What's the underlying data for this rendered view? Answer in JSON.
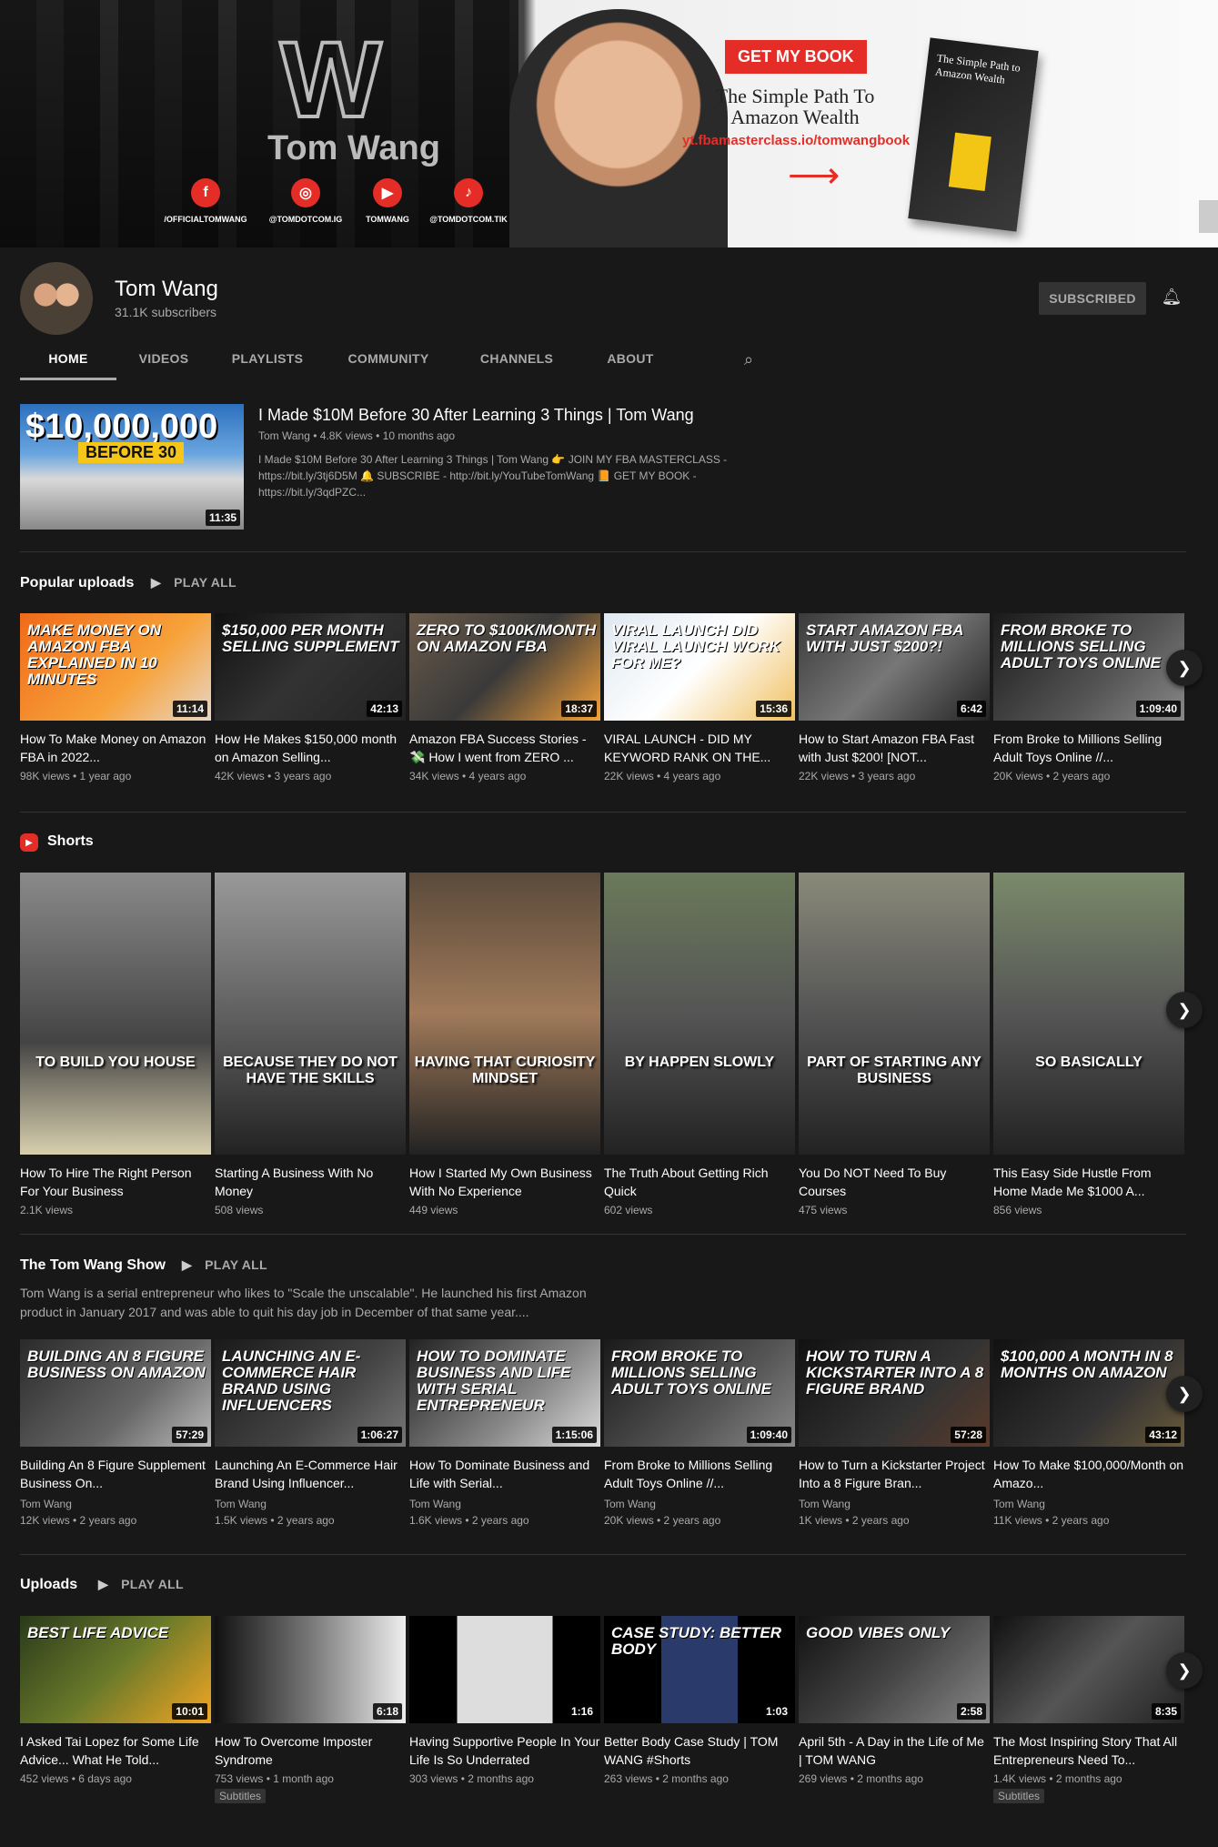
{
  "banner": {
    "logo_letter": "W",
    "logo_name": "Tom Wang",
    "socials": [
      {
        "icon": "facebook-icon",
        "glyph": "f",
        "label": "/OFFICIALTOMWANG"
      },
      {
        "icon": "instagram-icon",
        "glyph": "◎",
        "label": "@TOMDOTCOM.IG"
      },
      {
        "icon": "youtube-icon",
        "glyph": "▶",
        "label": "TOMWANG"
      },
      {
        "icon": "tiktok-icon",
        "glyph": "♪",
        "label": "@TOMDOTCOM.TIK"
      }
    ],
    "cta": "GET MY BOOK",
    "book_title": "The Simple Path To Amazon Wealth",
    "book_url": "yt.fbamasterclass.io/tomwangbook",
    "book_cover": "The Simple Path to Amazon Wealth"
  },
  "channel": {
    "name": "Tom Wang",
    "subscribers": "31.1K subscribers",
    "subscribe_label": "SUBSCRIBED"
  },
  "tabs": [
    "HOME",
    "VIDEOS",
    "PLAYLISTS",
    "COMMUNITY",
    "CHANNELS",
    "ABOUT"
  ],
  "featured": {
    "thumb_line1": "$10,000,000",
    "thumb_line2": "BEFORE 30",
    "duration": "11:35",
    "title": "I Made $10M Before 30 After Learning 3 Things | Tom Wang",
    "meta": "Tom Wang • 4.8K views • 10 months ago",
    "description": "I Made $10M Before 30 After Learning 3 Things | Tom Wang 👉 JOIN MY FBA MASTERCLASS - https://bit.ly/3tj6D5M 🔔 SUBSCRIBE - http://bit.ly/YouTubeTomWang 📙 GET MY BOOK - https://bit.ly/3qdPZC..."
  },
  "popular": {
    "title": "Popular uploads",
    "play_all": "PLAY ALL",
    "items": [
      {
        "cap": "MAKE MONEY ON AMAZON FBA explained in 10 minutes",
        "dur": "11:14",
        "title": "How To Make Money on Amazon FBA in 2022...",
        "meta": "98K views • 1 year ago",
        "bg": "linear-gradient(135deg,#f06a1a,#f7a23a 60%,#e7d6c5)"
      },
      {
        "cap": "$150,000 PER MONTH SELLING SUPPLEMENT",
        "dur": "42:13",
        "title": "How He Makes $150,000 month on Amazon Selling...",
        "meta": "42K views • 3 years ago",
        "bg": "linear-gradient(135deg,#111,#333 50%,#222)"
      },
      {
        "cap": "ZERO TO $100K/MONTH ON AMAZON FBA",
        "dur": "18:37",
        "title": "Amazon FBA Success Stories - 💸 How I went from ZERO ...",
        "meta": "34K views • 4 years ago",
        "bg": "linear-gradient(135deg,#6a5a4a,#3a3a3a 50%,#f7a23a)"
      },
      {
        "cap": "VIRAL LAUNCH DID VIRAL LAUNCH WORK FOR ME?",
        "dur": "15:36",
        "title": "VIRAL LAUNCH - DID MY KEYWORD RANK ON THE...",
        "meta": "22K views • 4 years ago",
        "bg": "linear-gradient(135deg,#dfe8f0,#ffffff 50%,#f0c060)"
      },
      {
        "cap": "START AMAZON FBA WITH JUST $200?!",
        "dur": "6:42",
        "title": "How to Start Amazon FBA Fast with Just $200! [NOT...",
        "meta": "22K views • 3 years ago",
        "bg": "linear-gradient(135deg,#3a3a3a,#777 50%,#222)"
      },
      {
        "cap": "FROM BROKE TO MILLIONS SELLING ADULT TOYS ONLINE",
        "dur": "1:09:40",
        "title": "From Broke to Millions Selling Adult Toys Online //...",
        "meta": "20K views • 2 years ago",
        "bg": "linear-gradient(135deg,#1a1a1a,#555 60%,#888)"
      }
    ]
  },
  "shorts": {
    "title": "Shorts",
    "items": [
      {
        "cap": "TO BUILD YOU HOUSE",
        "title": "How To Hire The Right Person For Your Business",
        "meta": "2.1K views",
        "bg": "linear-gradient(180deg,#8a8a8a,#444 60%,#d8cfae)"
      },
      {
        "cap": "BECAUSE THEY DO NOT HAVE THE SKILLS",
        "title": "Starting A Business With No Money",
        "meta": "508 views",
        "bg": "linear-gradient(180deg,#999,#555 60%,#222)"
      },
      {
        "cap": "HAVING THAT CURIOSITY MINDSET",
        "title": "How I Started My Own Business With No Experience",
        "meta": "449 views",
        "bg": "linear-gradient(180deg,#5a4a3a,#a07a5a 50%,#222)"
      },
      {
        "cap": "BY HAPPEN SLOWLY",
        "title": "The Truth About Getting Rich Quick",
        "meta": "602 views",
        "bg": "linear-gradient(180deg,#6a7a5a,#555 50%,#222)"
      },
      {
        "cap": "PART OF STARTING ANY BUSINESS",
        "title": "You Do NOT Need To Buy Courses",
        "meta": "475 views",
        "bg": "linear-gradient(180deg,#8a8a7a,#555 50%,#222)"
      },
      {
        "cap": "SO BASICALLY",
        "title": "This Easy Side Hustle From Home Made Me $1000 A...",
        "meta": "856 views",
        "bg": "linear-gradient(180deg,#7a8a6a,#555 50%,#222)"
      }
    ]
  },
  "show": {
    "title": "The Tom Wang Show",
    "play_all": "PLAY ALL",
    "description": "Tom Wang is a serial entrepreneur who likes to \"Scale the unscalable\". He launched his first Amazon product in January 2017 and was able to quit his day job in December of that same year....",
    "items": [
      {
        "cap": "BUILDING AN 8 FIGURE BUSINESS ON AMAZON",
        "dur": "57:29",
        "title": "Building An 8 Figure Supplement Business On...",
        "channel": "Tom Wang",
        "meta": "12K views • 2 years ago",
        "bg": "linear-gradient(135deg,#2a2a2a,#666 60%,#bbb)"
      },
      {
        "cap": "LAUNCHING AN E-COMMERCE HAIR BRAND USING INFLUENCERS",
        "dur": "1:06:27",
        "title": "Launching An E-Commerce Hair Brand Using Influencer...",
        "channel": "Tom Wang",
        "meta": "1.5K views • 2 years ago",
        "bg": "linear-gradient(135deg,#1a1a1a,#444 60%,#777)"
      },
      {
        "cap": "HOW TO DOMINATE BUSINESS AND LIFE WITH SERIAL ENTREPRENEUR",
        "dur": "1:15:06",
        "title": "How To Dominate Business and Life with Serial...",
        "channel": "Tom Wang",
        "meta": "1.6K views • 2 years ago",
        "bg": "linear-gradient(135deg,#222,#888 60%,#ddd)"
      },
      {
        "cap": "FROM BROKE TO MILLIONS SELLING ADULT TOYS ONLINE",
        "dur": "1:09:40",
        "title": "From Broke to Millions Selling Adult Toys Online //...",
        "channel": "Tom Wang",
        "meta": "20K views • 2 years ago",
        "bg": "linear-gradient(135deg,#1a1a1a,#555 60%,#888)"
      },
      {
        "cap": "HOW TO TURN A KICKSTARTER INTO A 8 FIGURE BRAND",
        "dur": "57:28",
        "title": "How to Turn a Kickstarter Project Into a 8 Figure Bran...",
        "channel": "Tom Wang",
        "meta": "1K views • 2 years ago",
        "bg": "linear-gradient(135deg,#111,#333 60%,#5a3a2a)"
      },
      {
        "cap": "$100,000 A MONTH IN 8 MONTHS ON AMAZON",
        "dur": "43:12",
        "title": "How To Make $100,000/Month on Amazo...",
        "channel": "Tom Wang",
        "meta": "11K views • 2 years ago",
        "bg": "linear-gradient(135deg,#111,#333 60%,#6a5a3a)"
      }
    ]
  },
  "uploads": {
    "title": "Uploads",
    "play_all": "PLAY ALL",
    "items": [
      {
        "cap": "BEST LIFE ADVICE",
        "dur": "10:01",
        "title": "I Asked Tai Lopez for Some Life Advice... What He Told...",
        "meta": "452 views • 6 days ago",
        "badge": "",
        "bg": "linear-gradient(135deg,#2a3a1a,#6a7a2a 50%,#f5a623)"
      },
      {
        "cap": "",
        "dur": "6:18",
        "title": "How To Overcome Imposter Syndrome",
        "meta": "753 views • 1 month ago",
        "badge": "Subtitles",
        "bg": "linear-gradient(90deg,#111,#777 50%,#eee)"
      },
      {
        "cap": "",
        "dur": "1:16",
        "title": "Having Supportive People In Your Life Is So Underrated",
        "meta": "303 views • 2 months ago",
        "badge": "",
        "bg": "linear-gradient(90deg,#000 25%,#ddd 25% 75%,#000 75%)"
      },
      {
        "cap": "CASE STUDY: BETTER BODY",
        "dur": "1:03",
        "title": "Better Body Case Study | TOM WANG #Shorts",
        "meta": "263 views • 2 months ago",
        "badge": "",
        "bg": "linear-gradient(90deg,#000 30%,#2a3a6a 30% 70%,#000 70%)"
      },
      {
        "cap": "GOOD VIBES ONLY",
        "dur": "2:58",
        "title": "April 5th - A Day in the Life of Me | TOM WANG",
        "meta": "269 views • 2 months ago",
        "badge": "",
        "bg": "linear-gradient(135deg,#111,#444 50%,#888)"
      },
      {
        "cap": "",
        "dur": "8:35",
        "title": "The Most Inspiring Story That All Entrepreneurs Need To...",
        "meta": "1.4K views • 2 months ago",
        "badge": "Subtitles",
        "bg": "linear-gradient(135deg,#111,#555 50%,#222)"
      }
    ]
  }
}
